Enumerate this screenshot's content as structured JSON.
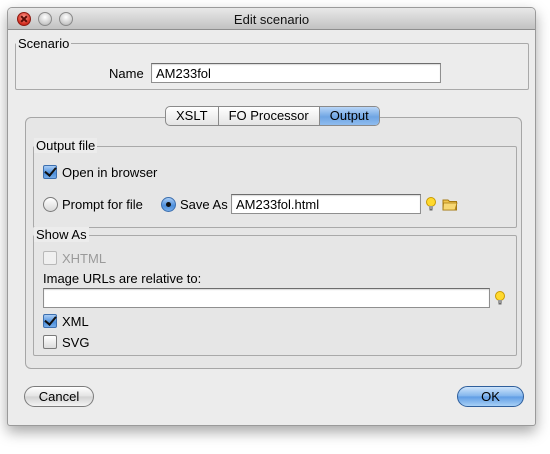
{
  "window": {
    "title": "Edit scenario"
  },
  "scenario": {
    "group_label": "Scenario",
    "name_label": "Name",
    "name_value": "AM233fol"
  },
  "tabs": [
    {
      "label": "XSLT",
      "active": false
    },
    {
      "label": "FO Processor",
      "active": false
    },
    {
      "label": "Output",
      "active": true
    }
  ],
  "output_file": {
    "group_label": "Output file",
    "open_in_browser": {
      "label": "Open in browser",
      "checked": true
    },
    "prompt_for_file": {
      "label": "Prompt for file",
      "selected": false
    },
    "save_as": {
      "label": "Save As",
      "selected": true,
      "value": "AM233fol.html"
    },
    "icons": [
      "lightbulb-icon",
      "folder-icon"
    ]
  },
  "show_as": {
    "group_label": "Show As",
    "xhtml": {
      "label": "XHTML",
      "checked": false,
      "disabled": true
    },
    "image_urls_label": "Image URLs are relative to:",
    "image_urls_value": "",
    "xml": {
      "label": "XML",
      "checked": true
    },
    "svg": {
      "label": "SVG",
      "checked": false
    }
  },
  "buttons": {
    "cancel": "Cancel",
    "ok": "OK"
  },
  "colors": {
    "accent": "#6fa5e3",
    "window_bg": "#ececec"
  }
}
